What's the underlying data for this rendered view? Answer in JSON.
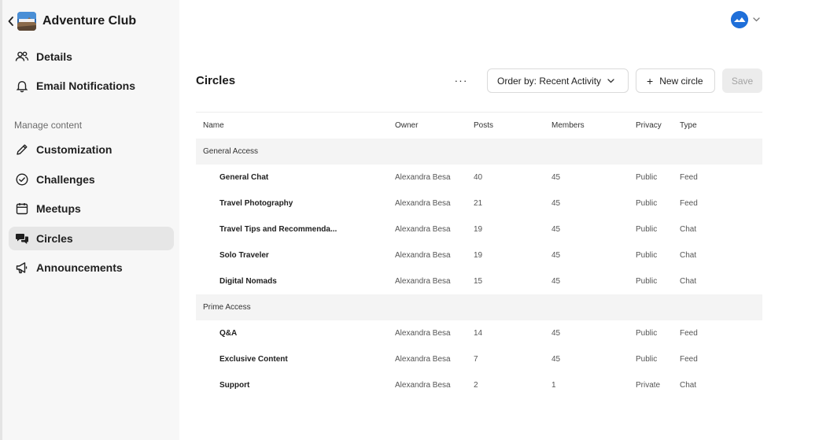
{
  "sidebar": {
    "brand_name": "Adventure Club",
    "logo_text": "ADVENTURE",
    "items_top": [
      {
        "label": "Details",
        "icon": "users-icon"
      },
      {
        "label": "Email Notifications",
        "icon": "bell-icon"
      }
    ],
    "section_title": "Manage content",
    "items": [
      {
        "label": "Customization",
        "icon": "pencil-icon"
      },
      {
        "label": "Challenges",
        "icon": "check-circle-icon"
      },
      {
        "label": "Meetups",
        "icon": "calendar-icon"
      },
      {
        "label": "Circles",
        "icon": "chat-bubbles-icon",
        "active": true
      },
      {
        "label": "Announcements",
        "icon": "megaphone-icon"
      }
    ]
  },
  "header": {
    "avatar_color": "#1f6fd9"
  },
  "main": {
    "title": "Circles",
    "more_label": "···",
    "order_label": "Order by: Recent Activity",
    "new_label": "New circle",
    "save_label": "Save",
    "columns": [
      "Name",
      "Owner",
      "Posts",
      "Members",
      "Privacy",
      "Type"
    ],
    "groups": [
      {
        "name": "General Access",
        "rows": [
          {
            "name": "General Chat",
            "owner": "Alexandra Besa",
            "posts": "40",
            "members": "45",
            "privacy": "Public",
            "type": "Feed"
          },
          {
            "name": "Travel Photography",
            "owner": "Alexandra Besa",
            "posts": "21",
            "members": "45",
            "privacy": "Public",
            "type": "Feed"
          },
          {
            "name": "Travel Tips and Recommenda...",
            "owner": "Alexandra Besa",
            "posts": "19",
            "members": "45",
            "privacy": "Public",
            "type": "Chat"
          },
          {
            "name": "Solo Traveler",
            "owner": "Alexandra Besa",
            "posts": "19",
            "members": "45",
            "privacy": "Public",
            "type": "Chat"
          },
          {
            "name": "Digital Nomads",
            "owner": "Alexandra Besa",
            "posts": "15",
            "members": "45",
            "privacy": "Public",
            "type": "Chat"
          }
        ]
      },
      {
        "name": "Prime Access",
        "rows": [
          {
            "name": "Q&A",
            "owner": "Alexandra Besa",
            "posts": "14",
            "members": "45",
            "privacy": "Public",
            "type": "Feed"
          },
          {
            "name": "Exclusive Content",
            "owner": "Alexandra Besa",
            "posts": "7",
            "members": "45",
            "privacy": "Public",
            "type": "Feed"
          },
          {
            "name": "Support",
            "owner": "Alexandra Besa",
            "posts": "2",
            "members": "1",
            "privacy": "Private",
            "type": "Chat"
          }
        ]
      }
    ]
  }
}
